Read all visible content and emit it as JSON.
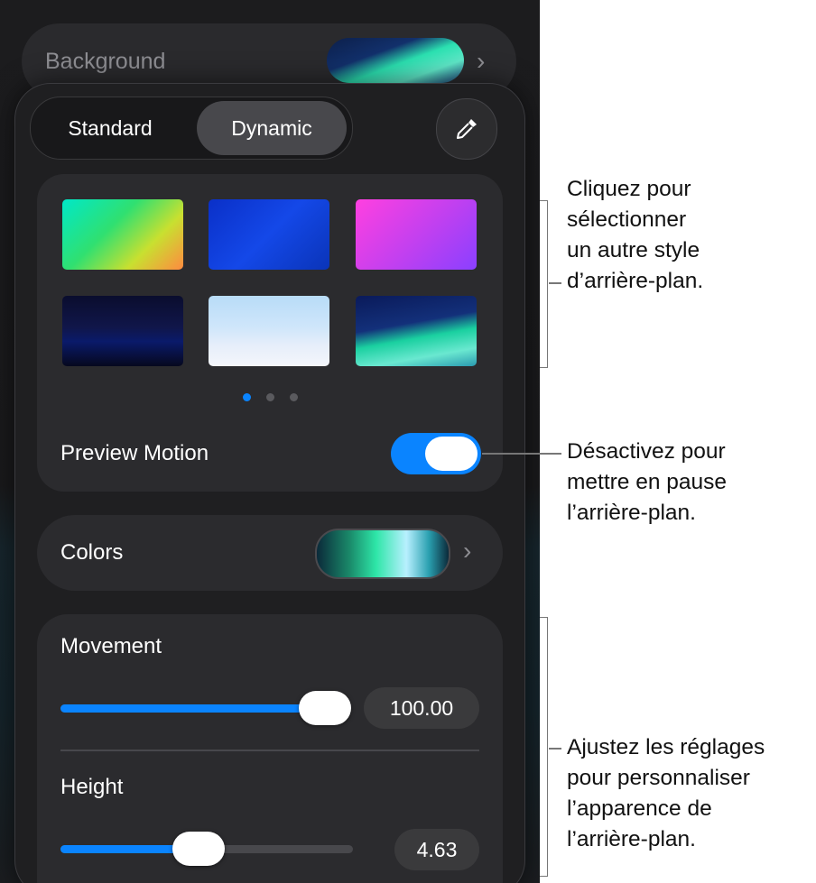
{
  "background_row": {
    "label": "Background",
    "chevron": "›"
  },
  "segmented": {
    "standard": "Standard",
    "dynamic": "Dynamic",
    "selected": "Dynamic"
  },
  "icons": {
    "picker": "eyedropper-icon"
  },
  "styles": {
    "swatches": [
      "gradient-green-orange",
      "blue",
      "magenta-violet",
      "dark-night",
      "light-sky",
      "ocean-dusk"
    ],
    "page_dots": {
      "count": 3,
      "active_index": 0
    }
  },
  "preview_motion": {
    "label": "Preview Motion",
    "enabled": true
  },
  "colors_row": {
    "label": "Colors",
    "chevron": "›"
  },
  "movement": {
    "label": "Movement",
    "value": "100.00",
    "fraction": 1.0
  },
  "height": {
    "label": "Height",
    "value": "4.63",
    "fraction": 0.45
  },
  "callouts": {
    "styles": [
      "Cliquez pour",
      "sélectionner",
      "un autre style",
      "d’arrière-plan."
    ],
    "toggle": [
      "Désactivez pour",
      "mettre en pause",
      "l’arrière-plan."
    ],
    "adjust": [
      "Ajustez les réglages",
      "pour personnaliser",
      "l’apparence de",
      "l’arrière-plan."
    ]
  },
  "colors": {
    "accent": "#0a84ff"
  }
}
